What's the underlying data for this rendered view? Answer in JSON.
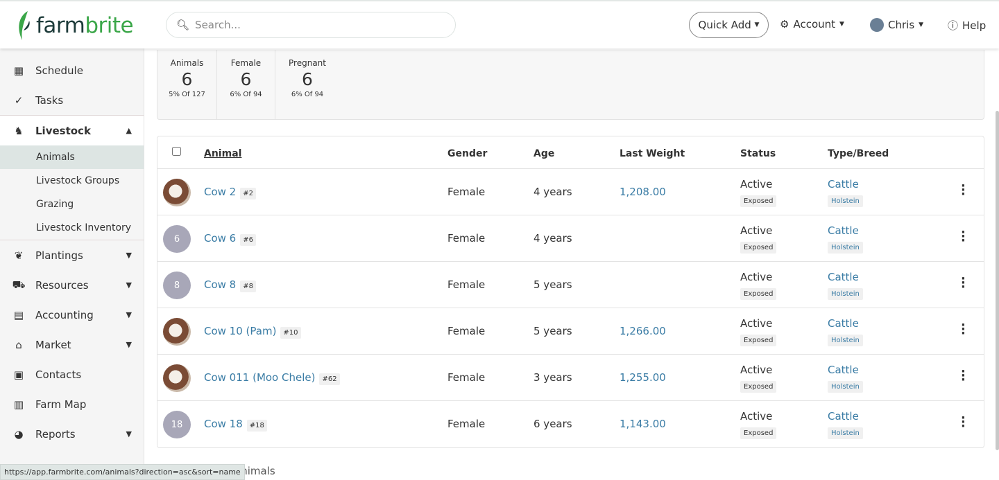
{
  "header": {
    "logo_a": "farm",
    "logo_b": "brite",
    "search_placeholder": "Search...",
    "quick_add": "Quick Add",
    "account": "Account",
    "user": "Chris",
    "help": "Help"
  },
  "sidebar": {
    "items": [
      {
        "label": "Schedule",
        "icon": "calendar-icon"
      },
      {
        "label": "Tasks",
        "icon": "check-circle-icon"
      },
      {
        "label": "Livestock",
        "icon": "horse-icon",
        "expanded": true,
        "sub": [
          "Animals",
          "Livestock Groups",
          "Grazing",
          "Livestock Inventory"
        ]
      },
      {
        "label": "Plantings",
        "icon": "seedling-icon"
      },
      {
        "label": "Resources",
        "icon": "tractor-icon"
      },
      {
        "label": "Accounting",
        "icon": "calculator-icon"
      },
      {
        "label": "Market",
        "icon": "store-icon"
      },
      {
        "label": "Contacts",
        "icon": "address-book-icon"
      },
      {
        "label": "Farm Map",
        "icon": "map-icon"
      },
      {
        "label": "Reports",
        "icon": "pie-chart-icon"
      }
    ]
  },
  "stats": [
    {
      "label": "Animals",
      "value": "6",
      "sub": "5% Of 127"
    },
    {
      "label": "Female",
      "value": "6",
      "sub": "6% Of 94"
    },
    {
      "label": "Pregnant",
      "value": "6",
      "sub": "6% Of 94"
    }
  ],
  "table": {
    "headers": [
      "Animal",
      "Gender",
      "Age",
      "Last Weight",
      "Status",
      "Type/Breed"
    ],
    "rows": [
      {
        "avatar": "photo",
        "name": "Cow 2",
        "tag": "#2",
        "gender": "Female",
        "age": "4 years",
        "weight": "1,208.00",
        "status": "Active",
        "status_tag": "Exposed",
        "type": "Cattle",
        "breed": "Holstein"
      },
      {
        "avatar": "6",
        "name": "Cow 6",
        "tag": "#6",
        "gender": "Female",
        "age": "4 years",
        "weight": "",
        "status": "Active",
        "status_tag": "Exposed",
        "type": "Cattle",
        "breed": "Holstein"
      },
      {
        "avatar": "8",
        "name": "Cow 8",
        "tag": "#8",
        "gender": "Female",
        "age": "5 years",
        "weight": "",
        "status": "Active",
        "status_tag": "Exposed",
        "type": "Cattle",
        "breed": "Holstein"
      },
      {
        "avatar": "photo",
        "name": "Cow 10 (Pam)",
        "tag": "#10",
        "gender": "Female",
        "age": "5 years",
        "weight": "1,266.00",
        "status": "Active",
        "status_tag": "Exposed",
        "type": "Cattle",
        "breed": "Holstein"
      },
      {
        "avatar": "photo",
        "name": "Cow 011 (Moo Chele)",
        "tag": "#62",
        "gender": "Female",
        "age": "3 years",
        "weight": "1,255.00",
        "status": "Active",
        "status_tag": "Exposed",
        "type": "Cattle",
        "breed": "Holstein"
      },
      {
        "avatar": "18",
        "name": "Cow 18",
        "tag": "#18",
        "gender": "Female",
        "age": "6 years",
        "weight": "1,143.00",
        "status": "Active",
        "status_tag": "Exposed",
        "type": "Cattle",
        "breed": "Holstein"
      }
    ]
  },
  "footer_text": "animals",
  "status_url": "https://app.farmbrite.com/animals?direction=asc&sort=name",
  "colors": {
    "brand_green": "#3aa648",
    "link": "#3a7ca5"
  }
}
